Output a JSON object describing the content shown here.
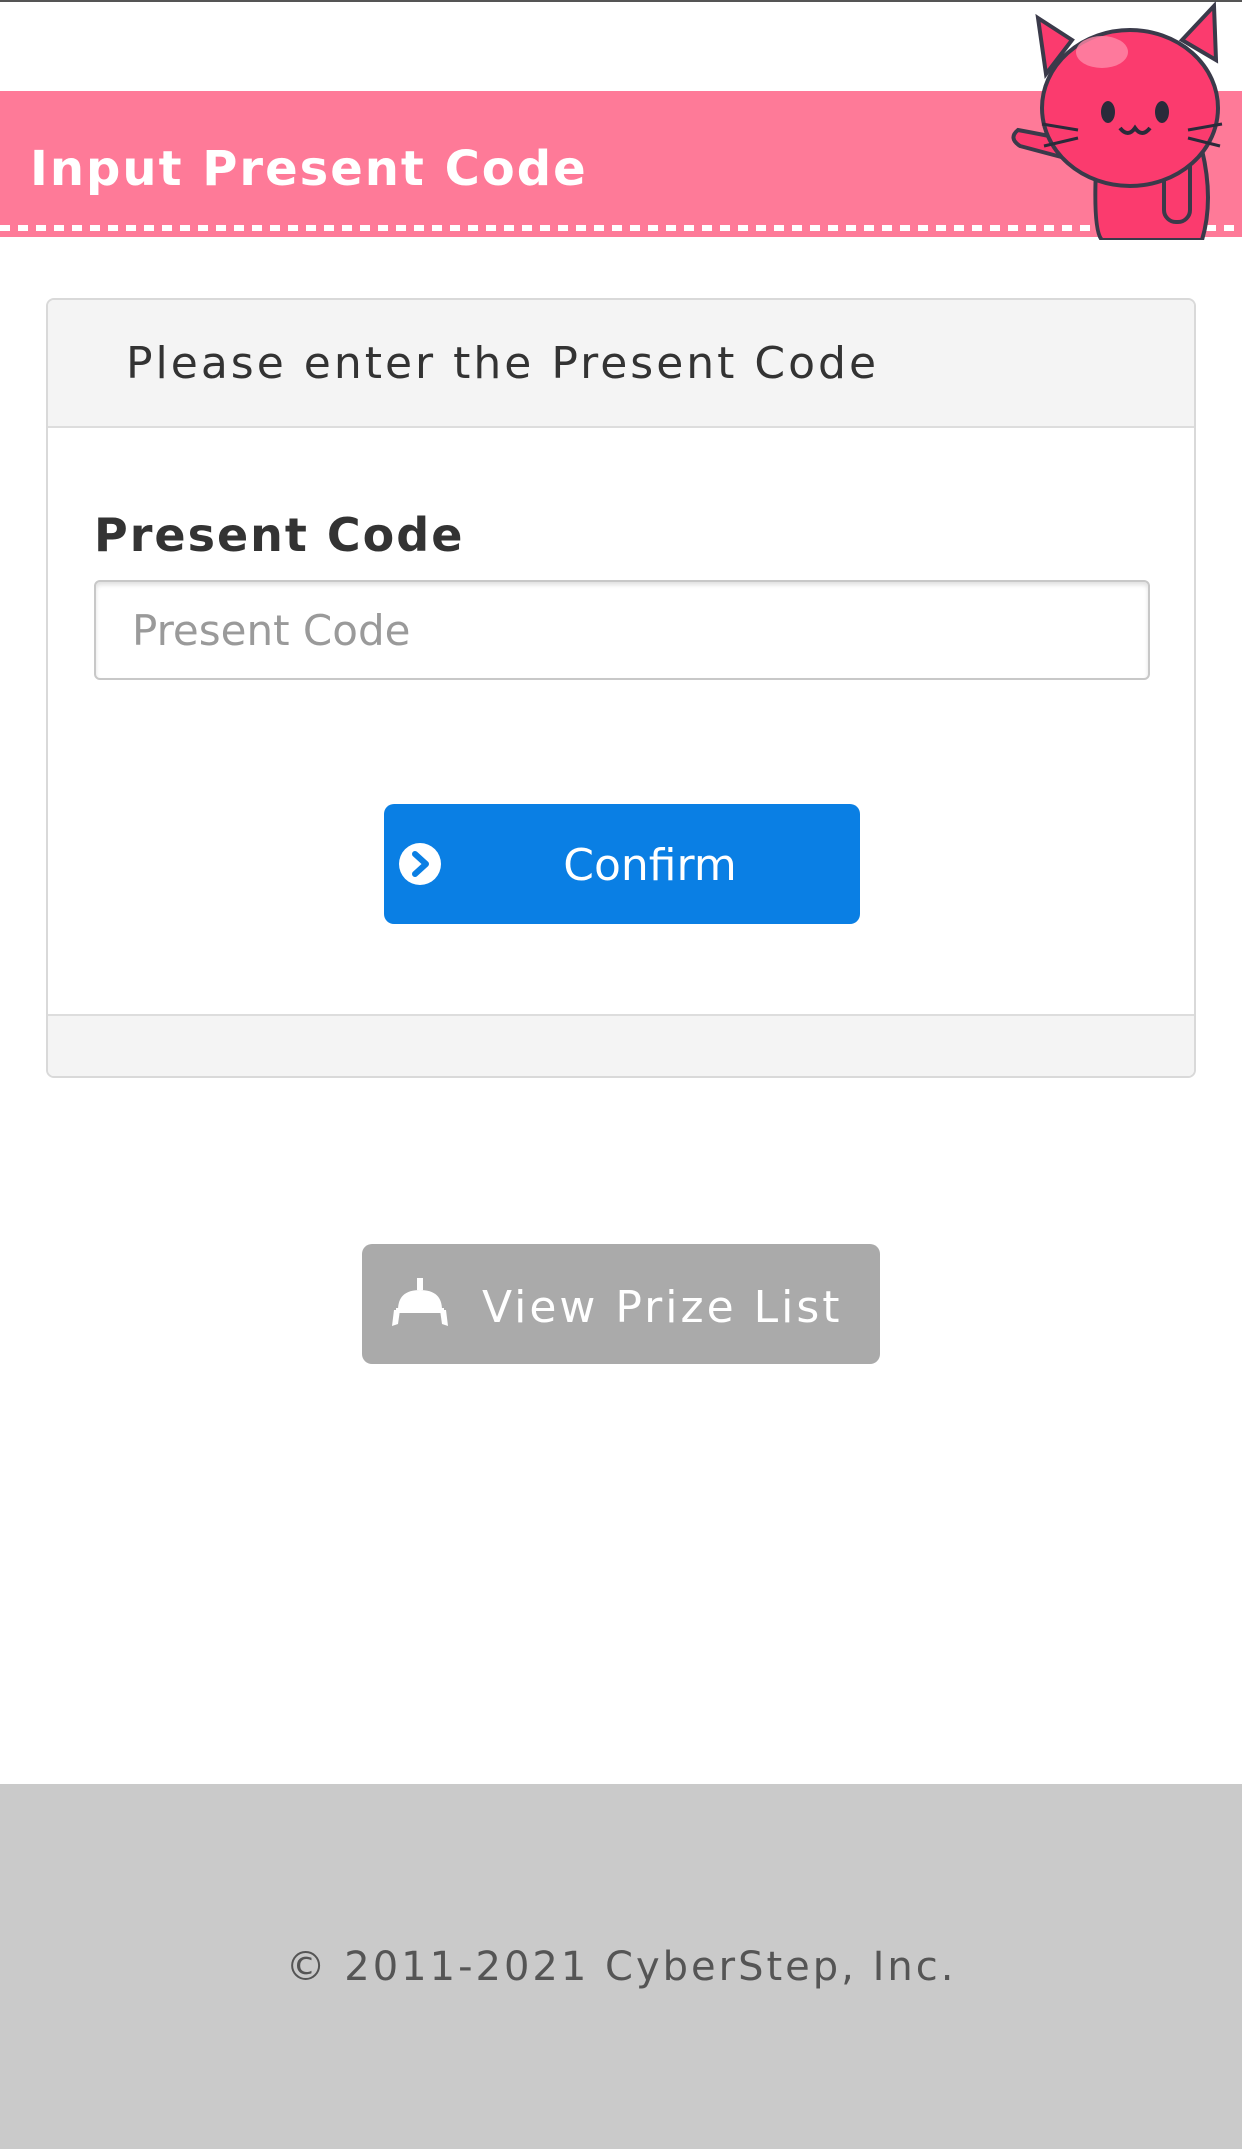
{
  "header": {
    "title": "Input Present Code",
    "mascot": "pink-cat-mascot",
    "color": "#fe7a98"
  },
  "panel": {
    "heading": "Please enter the Present Code",
    "field_label": "Present Code",
    "input_value": "",
    "input_placeholder": "Present Code",
    "confirm_label": "Confirm",
    "confirm_icon": "chevron-right-circle-icon",
    "confirm_color": "#0a7fe4"
  },
  "prize": {
    "label": "View Prize List",
    "icon": "crane-claw-icon",
    "color": "#aaaaaa"
  },
  "footer": {
    "copyright": "© 2011-2021 CyberStep, Inc."
  }
}
